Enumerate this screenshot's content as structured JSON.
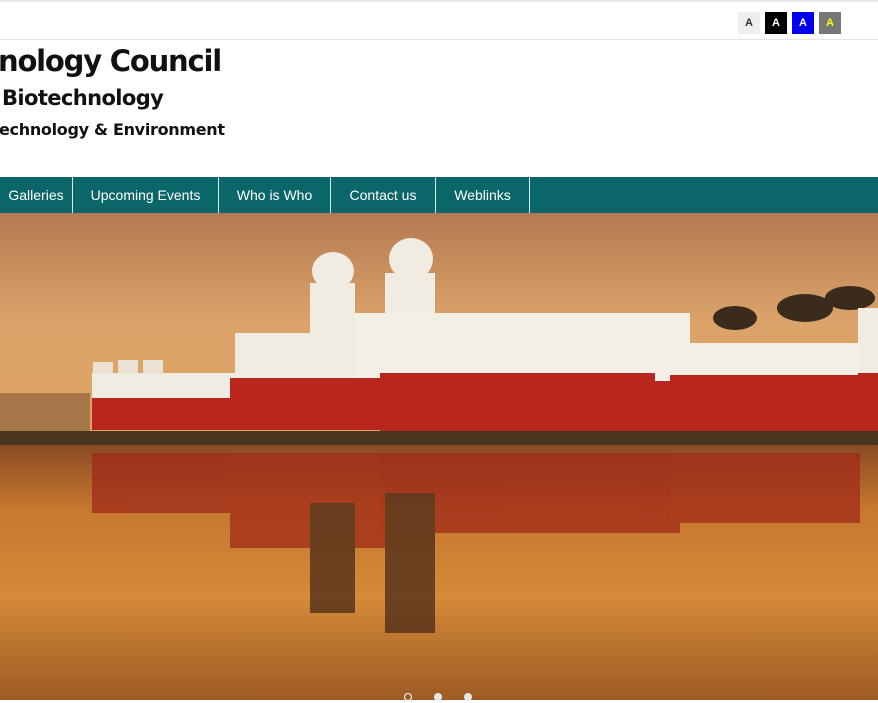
{
  "accessibility": {
    "options": [
      "A",
      "A",
      "A",
      "A"
    ],
    "colors": [
      "#eeeeee",
      "#000000",
      "#0000ee",
      "#777777"
    ]
  },
  "header": {
    "title": "nology Council",
    "subtitle": "Biotechnology",
    "tagline": "echnology & Environment"
  },
  "nav": {
    "items": [
      "Galleries",
      "Upcoming Events",
      "Who is Who",
      "Contact us",
      "Weblinks"
    ],
    "color": "#0b6669"
  },
  "carousel": {
    "slides": 3,
    "active_slide": 1
  }
}
